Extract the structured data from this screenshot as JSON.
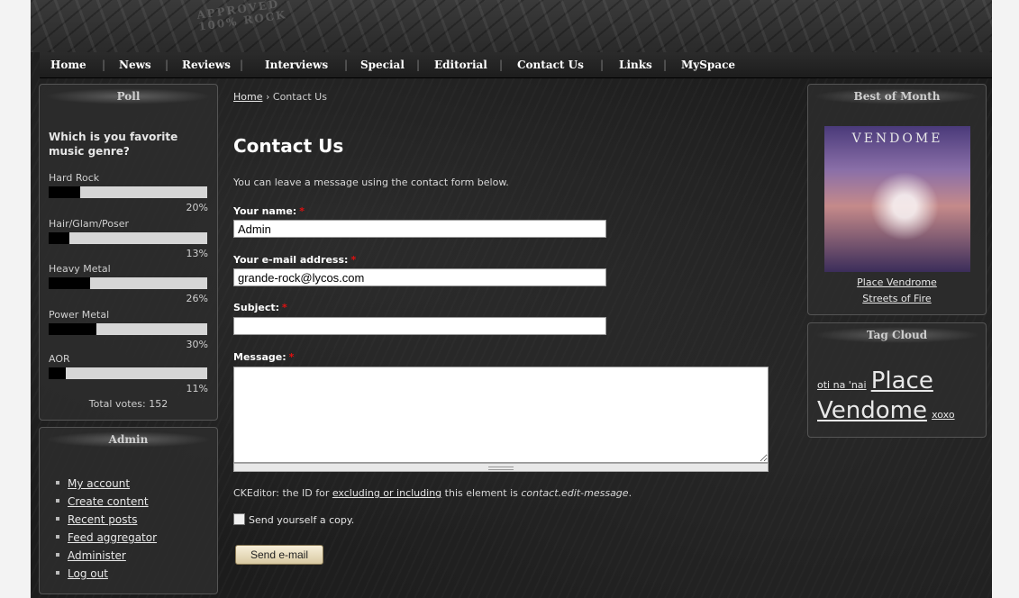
{
  "banner": {
    "stamp_text": "APPROVED\n100% ROCK"
  },
  "nav": {
    "items": [
      "Home",
      "News",
      "Reviews",
      "Interviews",
      "Special",
      "Editorial",
      "Contact Us",
      "Links",
      "MySpace"
    ]
  },
  "poll": {
    "title": "Poll",
    "question": "Which is you favorite music genre?",
    "options": [
      {
        "label": "Hard Rock",
        "percent_text": "20%",
        "value": 20
      },
      {
        "label": "Hair/Glam/Poser",
        "percent_text": "13%",
        "value": 13
      },
      {
        "label": "Heavy Metal",
        "percent_text": "26%",
        "value": 26
      },
      {
        "label": "Power Metal",
        "percent_text": "30%",
        "value": 30
      },
      {
        "label": "AOR",
        "percent_text": "11%",
        "value": 11
      }
    ],
    "total": "Total votes: 152"
  },
  "admin": {
    "title": "Admin",
    "links": [
      "My account",
      "Create content",
      "Recent posts",
      "Feed aggregator",
      "Administer",
      "Log out"
    ]
  },
  "breadcrumb": {
    "home": "Home",
    "separator": "›",
    "current": "Contact Us"
  },
  "main": {
    "title": "Contact Us",
    "intro": "You can leave a message using the contact form below.",
    "fields": {
      "name_label": "Your name:",
      "name_value": "Admin",
      "email_label": "Your e-mail address:",
      "email_value": "grande-rock@lycos.com",
      "subject_label": "Subject:",
      "subject_value": "",
      "message_label": "Message:",
      "message_value": "",
      "required_mark": "*"
    },
    "ckeditor": {
      "prefix": "CKEditor: the ID for ",
      "link": "excluding or including",
      "middle": " this element is ",
      "id": "contact.edit-message",
      "suffix": "."
    },
    "copy_label": "Send yourself a copy.",
    "submit_label": "Send e-mail"
  },
  "best_of_month": {
    "title": "Best of Month",
    "album_text": "VENDOME",
    "link1": "Place Vendrome",
    "link2": "Streets of Fire"
  },
  "tag_cloud": {
    "title": "Tag Cloud",
    "tags": [
      "oti na 'nai",
      "Place",
      "Vendome",
      "xoxo"
    ]
  }
}
